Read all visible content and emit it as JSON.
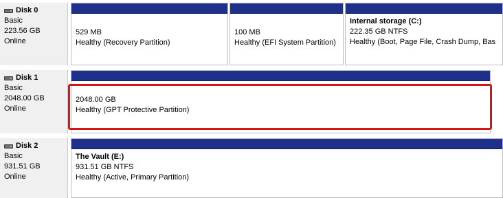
{
  "disks": [
    {
      "name": "Disk 0",
      "type": "Basic",
      "size": "223.56 GB",
      "status": "Online",
      "partitions": [
        {
          "title": "",
          "size": "529 MB",
          "status": "Healthy (Recovery Partition)"
        },
        {
          "title": "",
          "size": "100 MB",
          "status": "Healthy (EFI System Partition)"
        },
        {
          "title": "Internal storage  (C:)",
          "size": "222.35 GB NTFS",
          "status": "Healthy (Boot, Page File, Crash Dump, Bas"
        }
      ]
    },
    {
      "name": "Disk 1",
      "type": "Basic",
      "size": "2048.00 GB",
      "status": "Online",
      "partitions": [
        {
          "title": "",
          "size": "2048.00 GB",
          "status": "Healthy (GPT Protective Partition)"
        }
      ]
    },
    {
      "name": "Disk 2",
      "type": "Basic",
      "size": "931.51 GB",
      "status": "Online",
      "partitions": [
        {
          "title": "The Vault  (E:)",
          "size": "931.51 GB NTFS",
          "status": "Healthy (Active, Primary Partition)"
        }
      ]
    }
  ],
  "colors": {
    "partition_bar": "#1f2f8c",
    "highlight": "#d4161b",
    "info_panel": "#f0f0f0"
  },
  "icons": {
    "disk": "disk-drive-icon"
  }
}
